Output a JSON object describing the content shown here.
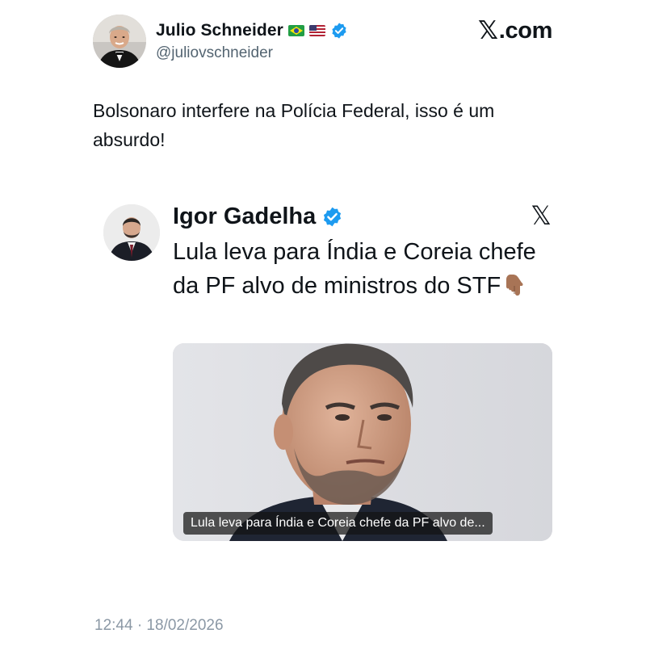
{
  "author": {
    "display_name": "Julio Schneider",
    "handle": "@juliovschneider",
    "flags": [
      "brazil-flag",
      "usa-flag"
    ],
    "verified": true
  },
  "brand": {
    "logo_text": ".com",
    "logo_mark": "𝕏"
  },
  "tweet": {
    "text": "Bolsonaro interfere na Polícia Federal, isso é um absurdo!"
  },
  "quoted": {
    "display_name": "Igor Gadelha",
    "verified": true,
    "x_icon": "𝕏",
    "text": "Lula leva para Índia e Coreia chefe da PF alvo de ministros do STF",
    "emoji": "backhand-index-pointing-down",
    "media_caption": "Lula leva para Índia e Coreia chefe da PF alvo de..."
  },
  "meta": {
    "timestamp": "12:44 · 18/02/2026"
  },
  "colors": {
    "text_primary": "#0f1419",
    "text_secondary": "#536471",
    "verified_blue": "#1d9bf0",
    "timestamp_gray": "#8b98a5"
  }
}
